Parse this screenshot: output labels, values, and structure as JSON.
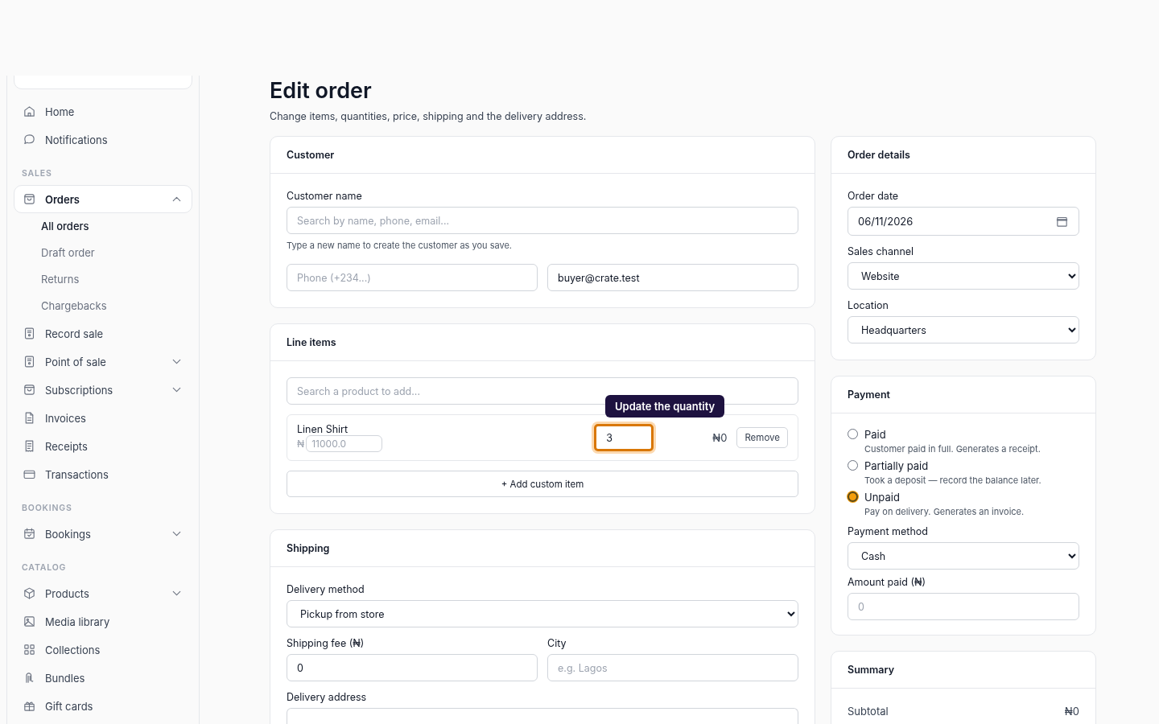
{
  "sidebar": {
    "sections": [
      {
        "items": [
          {
            "label": "Home",
            "selected": false
          },
          {
            "label": "Notifications",
            "selected": false
          }
        ]
      },
      {
        "heading": "SALES",
        "items": [
          {
            "label": "Orders",
            "selected": true,
            "expanded": true,
            "children": [
              {
                "label": "All orders",
                "selected": true
              },
              {
                "label": "Draft order",
                "selected": false
              },
              {
                "label": "Returns",
                "selected": false
              },
              {
                "label": "Chargebacks",
                "selected": false
              }
            ]
          },
          {
            "label": "Record sale",
            "selected": false
          },
          {
            "label": "Point of sale",
            "selected": false,
            "expanded": false
          },
          {
            "label": "Subscriptions",
            "selected": false,
            "expanded": false
          },
          {
            "label": "Invoices",
            "selected": false
          },
          {
            "label": "Receipts",
            "selected": false
          },
          {
            "label": "Transactions",
            "selected": false
          }
        ]
      },
      {
        "heading": "BOOKINGS",
        "items": [
          {
            "label": "Bookings",
            "selected": false,
            "expanded": false
          }
        ]
      },
      {
        "heading": "CATALOG",
        "items": [
          {
            "label": "Products",
            "selected": false,
            "expanded": false
          },
          {
            "label": "Media library",
            "selected": false
          },
          {
            "label": "Collections",
            "selected": false
          },
          {
            "label": "Bundles",
            "selected": false
          },
          {
            "label": "Gift cards",
            "selected": false
          }
        ]
      }
    ]
  },
  "page": {
    "title": "Edit order",
    "subtitle": "Change items, quantities, price, shipping and the delivery address."
  },
  "customer": {
    "title": "Customer",
    "name_label": "Customer name",
    "name_placeholder": "Search by name, phone, email...",
    "hint": "Type a new name to create the customer as you save.",
    "phone_placeholder": "Phone (+234...)",
    "email_value": "buyer@crate.test"
  },
  "line_items": {
    "title": "Line items",
    "search_placeholder": "Search a product to add...",
    "items": [
      {
        "name": "Linen Shirt",
        "currency": "₦",
        "price_placeholder": "11000.0",
        "quantity": "3",
        "quantity_focused": true,
        "total": "₦0",
        "remove": "Remove"
      }
    ],
    "tooltip": "Update the quantity",
    "add_button": "+ Add custom item"
  },
  "shipping": {
    "title": "Shipping",
    "method_label": "Delivery method",
    "method_value": "Pickup from store",
    "fee_label": "Shipping fee (₦)",
    "fee_value": "0",
    "city_label": "City",
    "city_placeholder": "e.g. Lagos",
    "address_label": "Delivery address"
  },
  "order_details": {
    "title": "Order details",
    "date_label": "Order date",
    "date_value": "06/11/2026",
    "channel_label": "Sales channel",
    "channel_value": "Website",
    "location_label": "Location",
    "location_value": "Headquarters"
  },
  "payment": {
    "title": "Payment",
    "options": [
      {
        "label": "Paid",
        "description": "Customer paid in full. Generates a receipt.",
        "selected": false
      },
      {
        "label": "Partially paid",
        "description": "Took a deposit — record the balance later.",
        "selected": false
      },
      {
        "label": "Unpaid",
        "description": "Pay on delivery. Generates an invoice.",
        "selected": true
      }
    ],
    "method_label": "Payment method",
    "method_value": "Cash",
    "amount_label": "Amount paid (₦)",
    "amount_placeholder": "0"
  },
  "summary": {
    "title": "Summary",
    "rows": [
      {
        "label": "Subtotal",
        "value": "₦0"
      }
    ]
  }
}
